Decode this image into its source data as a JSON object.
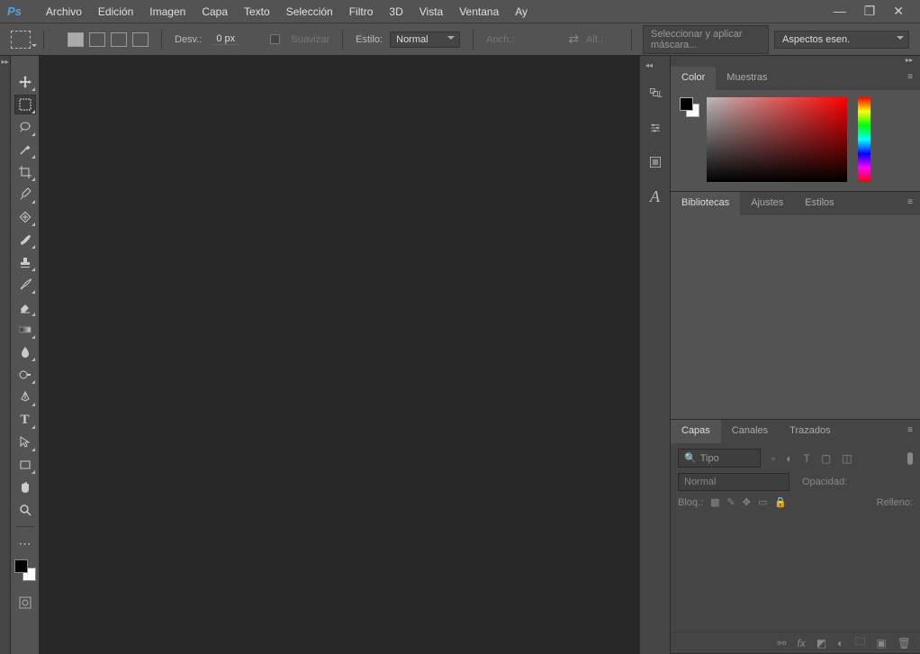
{
  "app": {
    "logo": "Ps"
  },
  "menu": [
    "Archivo",
    "Edición",
    "Imagen",
    "Capa",
    "Texto",
    "Selección",
    "Filtro",
    "3D",
    "Vista",
    "Ventana",
    "Ay"
  ],
  "options": {
    "desv_label": "Desv.:",
    "desv_value": "0 px",
    "suavizar": "Suavizar",
    "estilo_label": "Estilo:",
    "estilo_value": "Normal",
    "anch_label": "Anch.:",
    "alt_label": "Alt.:",
    "mask_btn": "Seleccionar y aplicar máscara...",
    "workspace": "Aspectos esen."
  },
  "panels": {
    "color": {
      "tab1": "Color",
      "tab2": "Muestras"
    },
    "lib": {
      "tab1": "Bibliotecas",
      "tab2": "Ajustes",
      "tab3": "Estilos"
    },
    "layers": {
      "tab1": "Capas",
      "tab2": "Canales",
      "tab3": "Trazados",
      "kind": "Tipo",
      "blend": "Normal",
      "opacity_label": "Opacidad:",
      "lock_label": "Bloq.:",
      "fill_label": "Relleno:"
    }
  }
}
